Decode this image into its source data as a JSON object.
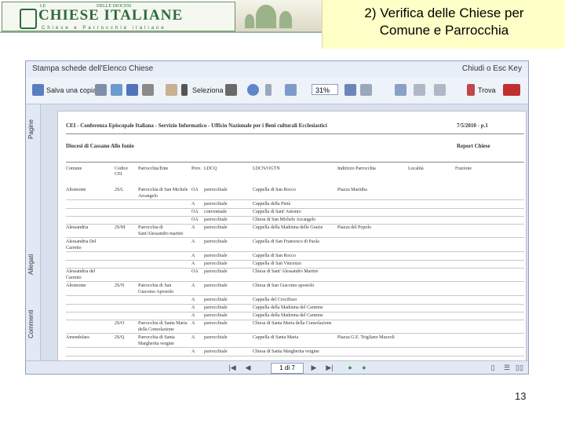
{
  "logo": {
    "le": "LE",
    "top_small": "DELLE DIOCESI",
    "title": "CHIESE ITALIANE",
    "subtitle": "Chiese e Parrocchie italiane"
  },
  "slide": {
    "title_line1": "2) Verifica delle Chiese per",
    "title_line2": "Comune e Parrocchia",
    "page_number": "13"
  },
  "window": {
    "title": "Stampa schede dell'Elenco Chiese",
    "close": "Chiudi o Esc Key"
  },
  "toolbar": {
    "save": "Salva una copia",
    "select": "Seleziona",
    "zoom": "31%",
    "find": "Trova"
  },
  "sidebar": {
    "tabs": [
      "Pagine",
      "Allegati",
      "Commenti"
    ]
  },
  "document": {
    "header": "CEI - Conferenza Episcopale Italiana - Servizio Informatico - Ufficio Nazionale per i Beni culturali Ecclesiastici",
    "date": "7/5/2010 - p.1",
    "diocese": "Diocesi di Cassano Allo Ionio",
    "report": "Report Chiese",
    "columns": [
      "Comune",
      "Codice CEI",
      "Parrocchia/Ente",
      "Prov.",
      "LDCQ",
      "LDCN/OGTN",
      "Indirizzo Parrocchia",
      "Località",
      "Frazione"
    ],
    "rows": [
      [
        "Altomonte",
        "2S/L",
        "Parrocchia di San Michele Arcangelo",
        "OA",
        "parrocchiale",
        "Cappella di San Rocco",
        "Piazza Maritiba"
      ],
      [
        "",
        "",
        "",
        "A",
        "parrocchiale",
        "Cappella della Pietà",
        ""
      ],
      [
        "",
        "",
        "",
        "OA",
        "conventuale",
        "Cappella di Sant' Antonio",
        ""
      ],
      [
        "",
        "",
        "",
        "OA",
        "parrocchiale",
        "Chiesa di San Michele Arcangelo",
        ""
      ],
      [
        "Alessandria",
        "2S/M",
        "Parrocchia di Sant'Alessandro martire",
        "A",
        "parrocchiale",
        "Cappella della Madonna delle Grazie",
        "Piazza del Popolo"
      ],
      [
        "Alessandria Del Carretto",
        "",
        "",
        "A",
        "parrocchiale",
        "Cappella di San Francesco di Paola",
        ""
      ],
      [
        "",
        "",
        "",
        "A",
        "parrocchiale",
        "Cappella di San Rocco",
        ""
      ],
      [
        "",
        "",
        "",
        "A",
        "parrocchiale",
        "Cappella di San Vincenzo",
        ""
      ],
      [
        "Alessandria del Carretto",
        "",
        "",
        "OA",
        "parrocchiale",
        "Chiesa di Sant' Alessandro Martire",
        ""
      ],
      [
        "Altomonte",
        "2S/N",
        "Parrocchia di San Giacomo Apostolo",
        "A",
        "parrocchiale",
        "Chiesa di San Giacomo apostolo",
        ""
      ],
      [
        "",
        "",
        "",
        "A",
        "parrocchiale",
        "Cappella del Crocifisso",
        ""
      ],
      [
        "",
        "",
        "",
        "A",
        "parrocchiale",
        "Cappella della Madonna del Carmine",
        ""
      ],
      [
        "",
        "",
        "",
        "A",
        "parrocchiale",
        "Cappella della Madonna del Carmine",
        ""
      ],
      [
        "",
        "2S/O",
        "Parrocchia di Santa Maria della Consolazione",
        "A",
        "parrocchiale",
        "Chiesa di Santa Maria della Consolazione",
        ""
      ],
      [
        "Amendolara",
        "2S/Q",
        "Parrocchia di Santa Margherita vergine",
        "A",
        "parrocchiale",
        "Cappella di Santa Maria",
        "Piazza G.E. Trigilano Mazzoli"
      ],
      [
        "",
        "",
        "",
        "A",
        "parrocchiale",
        "Chiesa di Santa Margherita vergine",
        ""
      ]
    ]
  },
  "status": {
    "page": "1 di 7"
  },
  "colors": {
    "title_bg": "#ffffc8",
    "logo_green": "#2f6a3a",
    "window_bg": "#d8e0ee"
  }
}
